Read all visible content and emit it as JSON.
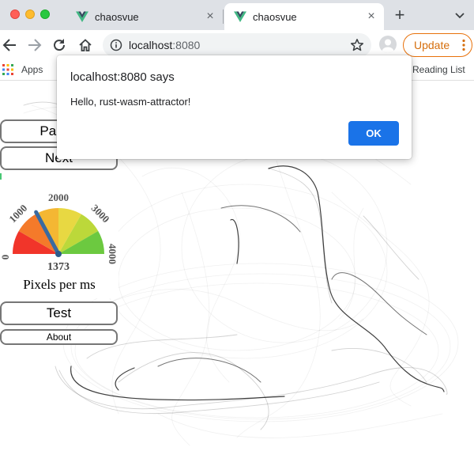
{
  "browser": {
    "tabs": [
      {
        "title": "chaosvue",
        "active": false
      },
      {
        "title": "chaosvue",
        "active": true
      }
    ],
    "address": {
      "host": "localhost",
      "port": ":8080"
    },
    "update_label": "Update",
    "bookmarks": {
      "apps_label": "Apps",
      "reading_list_label": "Reading List"
    }
  },
  "dialog": {
    "title": "localhost:8080 says",
    "message": "Hello, rust-wasm-attractor!",
    "ok_label": "OK"
  },
  "page": {
    "buttons": {
      "pause_label": "Pause",
      "next_label": "Next",
      "test_label": "Test",
      "about_label": "About"
    },
    "gauge": {
      "value": 1373,
      "value_label": "1373",
      "min": 0,
      "max": 4000,
      "ticks": [
        "0",
        "1000",
        "2000",
        "3000",
        "4000"
      ],
      "caption": "Pixels per ms",
      "segment_colors": [
        "#f1352a",
        "#f47a2a",
        "#f4b733",
        "#e8d842",
        "#bcd83a",
        "#6cc940"
      ],
      "needle_color": "#3a6aa0"
    }
  },
  "colors": {
    "accent": "#1a73e8",
    "update": "#e8710a",
    "tabstrip": "#dee1e6"
  }
}
